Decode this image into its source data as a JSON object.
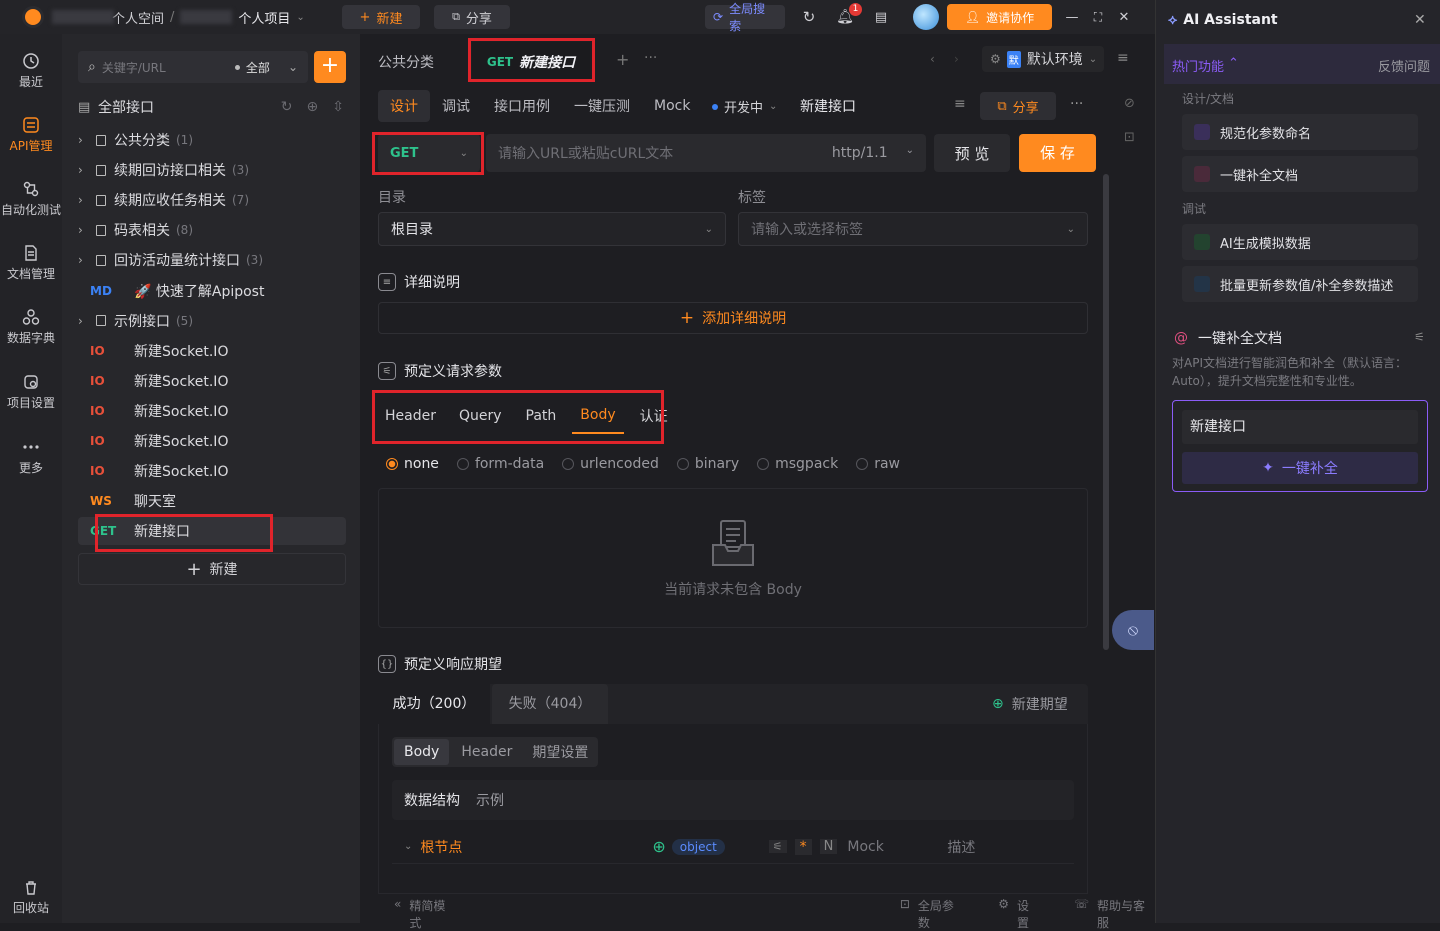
{
  "titlebar": {
    "breadcrumb_workspace": "个人空间",
    "breadcrumb_sep": "/",
    "breadcrumb_project": "个人项目",
    "new_label": "新建",
    "share_label": "分享",
    "global_search": "全局搜索",
    "notification_count": "1",
    "invite_label": "邀请协作"
  },
  "rail": {
    "items": [
      {
        "label": "最近",
        "icon": "clock-icon"
      },
      {
        "label": "API管理",
        "icon": "api-icon"
      },
      {
        "label": "自动化测试",
        "icon": "automation-icon"
      },
      {
        "label": "文档管理",
        "icon": "document-icon"
      },
      {
        "label": "数据字典",
        "icon": "dictionary-icon"
      },
      {
        "label": "项目设置",
        "icon": "settings-icon"
      },
      {
        "label": "更多",
        "icon": "more-icon"
      },
      {
        "label": "回收站",
        "icon": "trash-icon"
      }
    ]
  },
  "tree": {
    "search_placeholder": "关键字/URL",
    "filter_label": "全部",
    "all_label": "全部接口",
    "items": [
      {
        "type": "folder",
        "label": "公共分类",
        "count": "(1)"
      },
      {
        "type": "folder",
        "label": "续期回访接口相关",
        "count": "(3)"
      },
      {
        "type": "folder",
        "label": "续期应收任务相关",
        "count": "(7)"
      },
      {
        "type": "folder",
        "label": "码表相关",
        "count": "(8)"
      },
      {
        "type": "folder",
        "label": "回访活动量统计接口",
        "count": "(3)"
      },
      {
        "type": "md",
        "tag": "MD",
        "label": "🚀 快速了解Apipost"
      },
      {
        "type": "folder",
        "label": "示例接口",
        "count": "(5)"
      },
      {
        "type": "io",
        "tag": "IO",
        "label": "新建Socket.IO"
      },
      {
        "type": "io",
        "tag": "IO",
        "label": "新建Socket.IO"
      },
      {
        "type": "io",
        "tag": "IO",
        "label": "新建Socket.IO"
      },
      {
        "type": "io",
        "tag": "IO",
        "label": "新建Socket.IO"
      },
      {
        "type": "io",
        "tag": "IO",
        "label": "新建Socket.IO"
      },
      {
        "type": "ws",
        "tag": "WS",
        "label": "聊天室"
      },
      {
        "type": "get",
        "tag": "GET",
        "label": "新建接口"
      }
    ],
    "new_label": "新建"
  },
  "tabs": {
    "public": "公共分类",
    "active_method": "GET",
    "active_name": "新建接口",
    "env_label": "默认环境",
    "env_badge": "默"
  },
  "subtabs": [
    "设计",
    "调试",
    "接口用例",
    "一键压测",
    "Mock"
  ],
  "status": "开发中",
  "api_name": "新建接口",
  "share_label": "分享",
  "request": {
    "method": "GET",
    "url_placeholder": "请输入URL或粘贴cURL文本",
    "protocol": "http/1.1",
    "preview_label": "预 览",
    "save_label": "保 存"
  },
  "directory": {
    "label": "目录",
    "value": "根目录"
  },
  "tags": {
    "label": "标签",
    "placeholder": "请输入或选择标签"
  },
  "detail": {
    "title": "详细说明",
    "add_label": "添加详细说明"
  },
  "params": {
    "title": "预定义请求参数",
    "tabs": [
      "Header",
      "Query",
      "Path",
      "Body",
      "认证"
    ],
    "active_tab": "Body",
    "body_types": [
      "none",
      "form-data",
      "urlencoded",
      "binary",
      "msgpack",
      "raw"
    ],
    "selected_type": "none",
    "empty_text": "当前请求未包含 Body"
  },
  "response": {
    "title": "预定义响应期望",
    "tabs": [
      "成功（200）",
      "失败（404）"
    ],
    "new_expect": "新建期望",
    "sub_tabs": [
      "Body",
      "Header",
      "期望设置"
    ],
    "struct_tabs": [
      "数据结构",
      "示例"
    ],
    "root_label": "根节点",
    "type_badge": "object",
    "mock_label": "Mock",
    "desc_label": "描述",
    "required_mark": "*",
    "null_mark": "N"
  },
  "statusbar": {
    "mode": "精简模式",
    "global_params": "全局参数",
    "settings": "设置",
    "help": "帮助与客服"
  },
  "ai": {
    "title": "AI Assistant",
    "hot_label": "热门功能",
    "feedback": "反馈问题",
    "group1": "设计/文档",
    "items1": [
      "规范化参数命名",
      "一键补全文档"
    ],
    "group2": "调试",
    "items2": [
      "AI生成模拟数据",
      "批量更新参数值/补全参数描述"
    ],
    "feature_title": "一键补全文档",
    "feature_desc": "对API文档进行智能润色和补全（默认语言：Auto），提升文档完整性和专业性。",
    "input_value": "新建接口",
    "action_label": "一键补全"
  },
  "colors": {
    "accent": "#ff8a1f",
    "purple": "#8b5cf6",
    "blue": "#3b82f6",
    "highlight": "#e0242b"
  }
}
